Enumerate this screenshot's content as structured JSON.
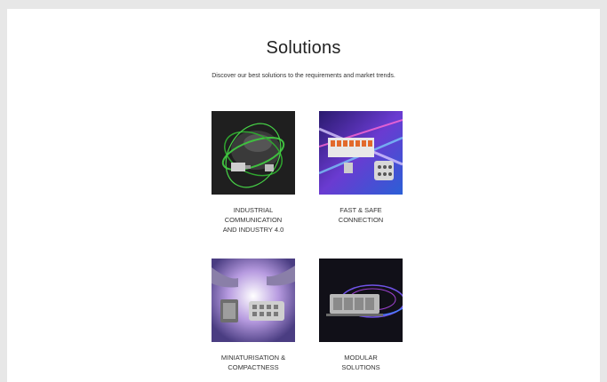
{
  "page": {
    "title": "Solutions",
    "subtitle": "Discover our best solutions to the requirements and market trends."
  },
  "solutions": [
    {
      "label": "INDUSTRIAL\nCOMMUNICATION\nAND INDUSTRY 4.0",
      "image": "globe-connector-image"
    },
    {
      "label": "FAST & SAFE\nCONNECTION",
      "image": "connector-lightstreaks-image"
    },
    {
      "label": "MINIATURISATION &\nCOMPACTNESS",
      "image": "hands-connector-image"
    },
    {
      "label": "MODULAR\nSOLUTIONS",
      "image": "modular-connector-image"
    }
  ]
}
